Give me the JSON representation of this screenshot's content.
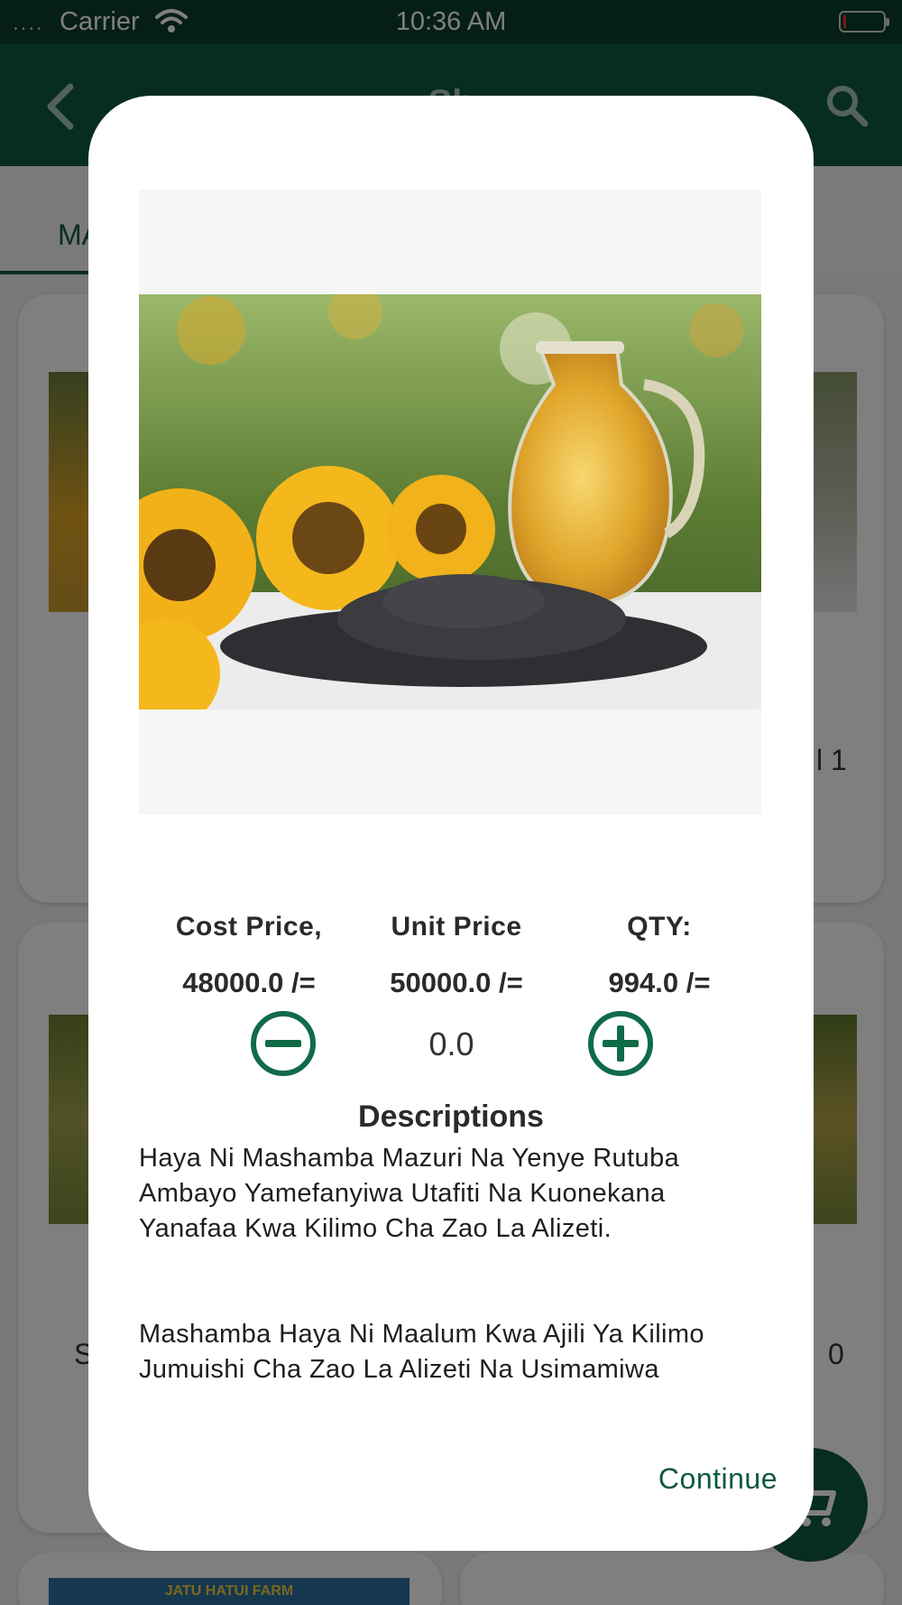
{
  "status_bar": {
    "carrier": "Carrier",
    "time": "10:36 AM",
    "signal_dots": "....",
    "battery_color": "#e53935"
  },
  "app_bar": {
    "title_partial": "Sh",
    "back_icon": "chevron-left-icon",
    "search_icon": "search-icon"
  },
  "tabs": {
    "active_label_partial": "MA"
  },
  "background_cards": {
    "card1_right_text": "l 1",
    "card2_left_text": "S",
    "card2_right_text": "0",
    "bottom_banner_text": "JATU HATUI FARM"
  },
  "dialog": {
    "image_icon": "product-photo-sunflower-oil",
    "cost_price_label": "Cost Price,",
    "cost_price_value": "48000.0 /=",
    "unit_price_label": "Unit Price",
    "unit_price_value": "50000.0 /=",
    "qty_label": "QTY:",
    "qty_value": "994.0 /=",
    "quantity": "0.0",
    "minus_icon": "minus-circle-icon",
    "plus_icon": "plus-circle-icon",
    "descriptions_heading": "Descriptions",
    "description_p1": "Haya Ni Mashamba Mazuri Na Yenye Rutuba Ambayo Yamefanyiwa Utafiti Na Kuonekana Yanafaa Kwa Kilimo Cha Zao La Alizeti.",
    "description_p2": "Mashamba Haya Ni Maalum Kwa Ajili Ya Kilimo Jumuishi Cha Zao La Alizeti Na Usimamiwa",
    "continue_label": "Continue"
  },
  "colors": {
    "status_bar": "#0b3d2c",
    "app_bar": "#0f5a3f",
    "accent": "#0f5a3f",
    "icon_green": "#0f6b48"
  },
  "fab": {
    "icon": "cart-icon"
  }
}
